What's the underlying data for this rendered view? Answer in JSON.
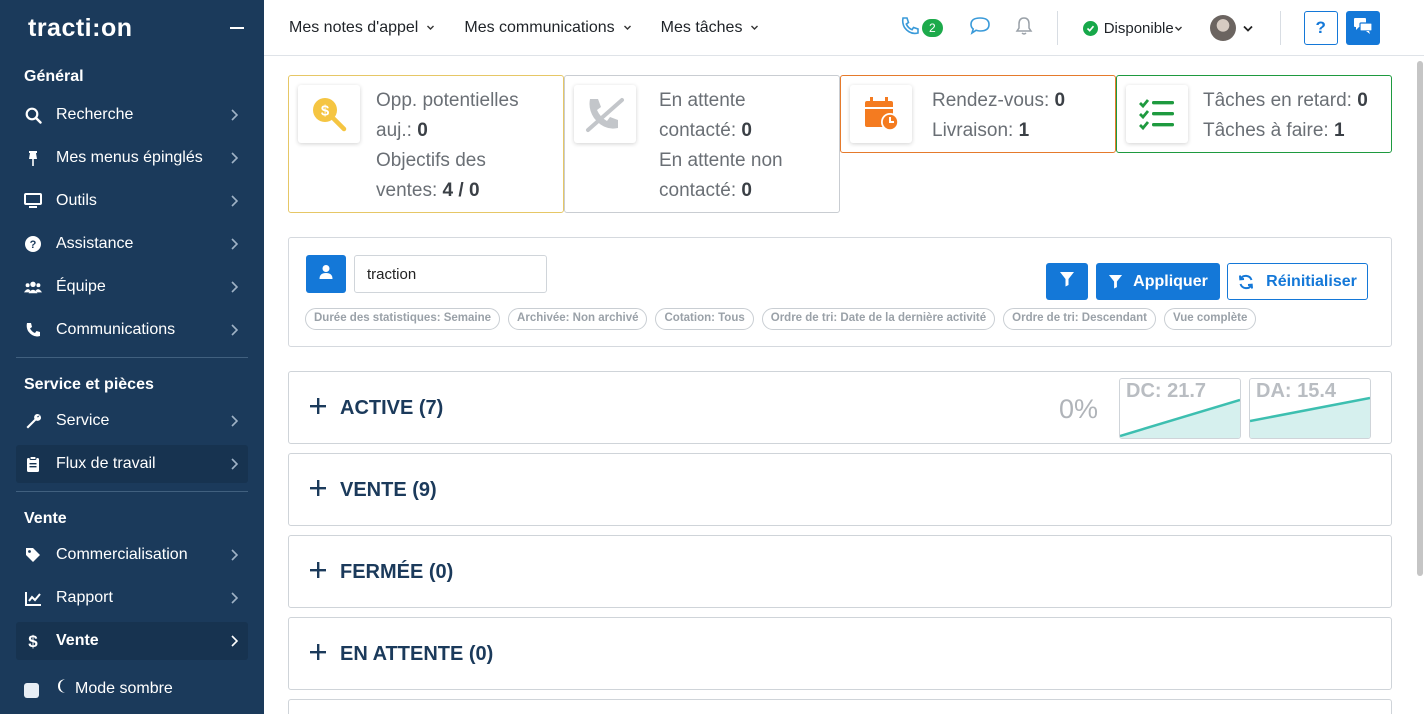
{
  "sidebar": {
    "logo": "tracti:on",
    "sections": {
      "general": "Général",
      "service": "Service et pièces",
      "vente": "Vente"
    },
    "items": [
      {
        "label": "Recherche"
      },
      {
        "label": "Mes menus épinglés"
      },
      {
        "label": "Outils"
      },
      {
        "label": "Assistance"
      },
      {
        "label": "Équipe"
      },
      {
        "label": "Communications"
      },
      {
        "label": "Service"
      },
      {
        "label": "Flux de travail"
      },
      {
        "label": "Commercialisation"
      },
      {
        "label": "Rapport"
      },
      {
        "label": "Vente"
      }
    ],
    "dark_mode": "Mode sombre"
  },
  "topbar": {
    "menus": [
      "Mes notes d'appel",
      "Mes communications",
      "Mes tâches"
    ],
    "call_badge": "2",
    "status": "Disponible",
    "help": "?"
  },
  "cards": {
    "opp": {
      "l1": "Opp. potentielles",
      "l2": "auj.:",
      "v1": "0",
      "l3": "Objectifs des",
      "l4": "ventes:",
      "v2": "4 / 0"
    },
    "attente": {
      "l1": "En attente",
      "l2": "contacté:",
      "v1": "0",
      "l3": "En attente non",
      "l4": "contacté:",
      "v2": "0"
    },
    "rdv": {
      "l1": "Rendez-vous:",
      "v1": "0",
      "l2": "Livraison:",
      "v2": "1"
    },
    "taches": {
      "l1": "Tâches en retard:",
      "v1": "0",
      "l2": "Tâches à faire:",
      "v2": "1"
    },
    "colors": {
      "opp": "#e6c766",
      "attente": "#c9cdd2",
      "rdv": "#e57a2c",
      "taches": "#1e9a3f"
    }
  },
  "filter": {
    "search_value": "traction",
    "apply": "Appliquer",
    "reset": "Réinitialiser",
    "chips": [
      "Durée des statistiques: Semaine",
      "Archivée: Non archivé",
      "Cotation: Tous",
      "Ordre de tri: Date de la dernière activité",
      "Ordre de tri: Descendant",
      "Vue complète"
    ]
  },
  "sections": [
    {
      "title": "ACTIVE (7)",
      "percent": "0%",
      "dc": "DC: 21.7",
      "da": "DA: 15.4"
    },
    {
      "title": "VENTE (9)"
    },
    {
      "title": "FERMÉE (0)"
    },
    {
      "title": "EN ATTENTE (0)"
    }
  ],
  "colors": {
    "accent": "#1478d8",
    "sidebar": "#1b3a5b",
    "spark": "#3dbfb0"
  }
}
